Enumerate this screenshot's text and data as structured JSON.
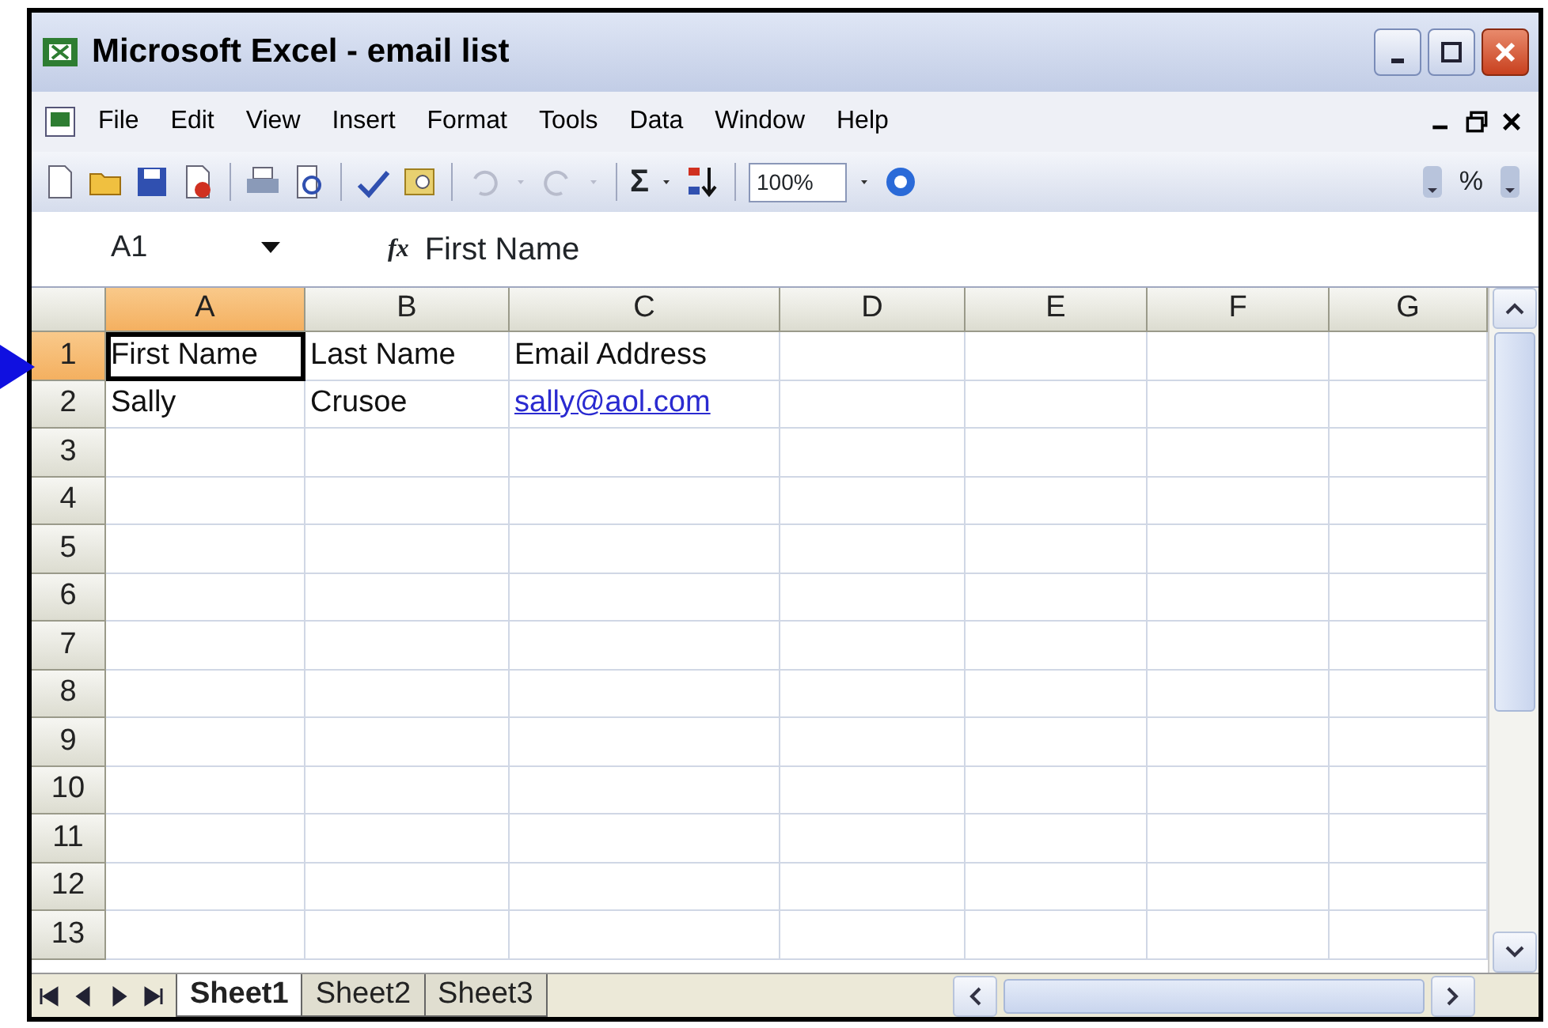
{
  "window": {
    "title": "Microsoft Excel - email list"
  },
  "menu": [
    {
      "label": "File"
    },
    {
      "label": "Edit"
    },
    {
      "label": "View"
    },
    {
      "label": "Insert"
    },
    {
      "label": "Format"
    },
    {
      "label": "Tools"
    },
    {
      "label": "Data"
    },
    {
      "label": "Window"
    },
    {
      "label": "Help"
    }
  ],
  "toolbar": {
    "sum_symbol": "Σ",
    "zoom": "100%",
    "percent": "%"
  },
  "formula_bar": {
    "name_box": "A1",
    "fx": "fx",
    "value": "First Name"
  },
  "columns": [
    {
      "label": "A",
      "selected": true
    },
    {
      "label": "B",
      "selected": false
    },
    {
      "label": "C",
      "selected": false
    },
    {
      "label": "D",
      "selected": false
    },
    {
      "label": "E",
      "selected": false
    },
    {
      "label": "F",
      "selected": false
    },
    {
      "label": "G",
      "selected": false
    }
  ],
  "rows": [
    {
      "label": "1",
      "selected": true,
      "cells": [
        {
          "kind": "text",
          "text": "First Name",
          "active": true
        },
        {
          "kind": "text",
          "text": "Last Name",
          "active": false
        },
        {
          "kind": "text",
          "text": "Email Address",
          "active": false
        }
      ]
    },
    {
      "label": "2",
      "selected": false,
      "cells": [
        {
          "kind": "text",
          "text": "Sally",
          "active": false
        },
        {
          "kind": "text",
          "text": "Crusoe",
          "active": false
        },
        {
          "kind": "link",
          "text": "sally@aol.com",
          "active": false
        }
      ]
    },
    {
      "label": "3",
      "selected": false
    },
    {
      "label": "4",
      "selected": false
    },
    {
      "label": "5",
      "selected": false
    },
    {
      "label": "6",
      "selected": false
    },
    {
      "label": "7",
      "selected": false
    },
    {
      "label": "8",
      "selected": false
    },
    {
      "label": "9",
      "selected": false
    },
    {
      "label": "10",
      "selected": false
    },
    {
      "label": "11",
      "selected": false
    },
    {
      "label": "12",
      "selected": false
    },
    {
      "label": "13",
      "selected": false
    }
  ],
  "sheet_tabs": [
    {
      "label": "Sheet1",
      "selected": true
    },
    {
      "label": "Sheet2",
      "selected": false
    },
    {
      "label": "Sheet3",
      "selected": false
    }
  ]
}
